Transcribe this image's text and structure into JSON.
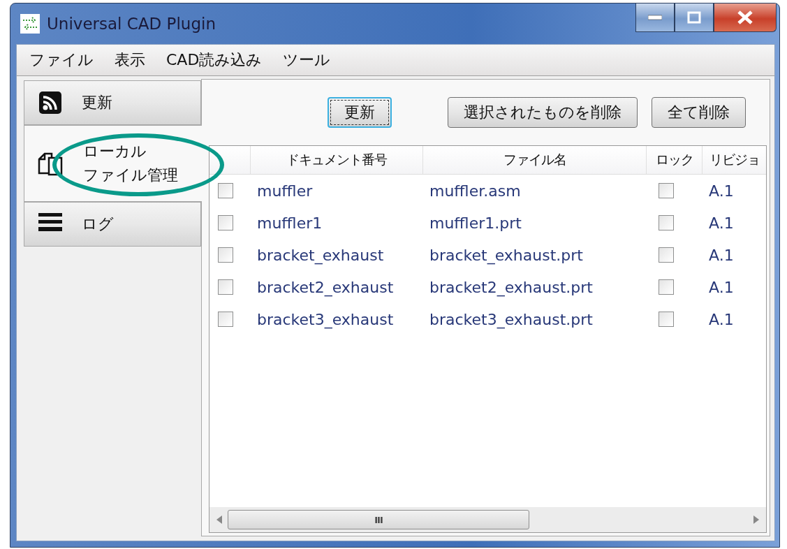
{
  "window": {
    "title": "Universal CAD Plugin"
  },
  "menu": [
    "ファイル",
    "表示",
    "CAD読み込み",
    "ツール"
  ],
  "sidebar": {
    "items": [
      {
        "lines": [
          "更新"
        ],
        "kind": "rss",
        "selected": false
      },
      {
        "lines": [
          "ローカル",
          "ファイル管理"
        ],
        "kind": "files",
        "selected": true
      },
      {
        "lines": [
          "ログ"
        ],
        "kind": "list",
        "selected": false
      }
    ]
  },
  "toolbar": {
    "buttons": [
      {
        "label": "更新",
        "focused": true
      },
      {
        "label": "選択されたものを削除",
        "focused": false
      },
      {
        "label": "全て削除",
        "focused": false
      }
    ]
  },
  "table": {
    "columns": [
      "ドキュメント番号",
      "ファイル名",
      "ロック",
      "リビジョ"
    ],
    "rows": [
      {
        "checked": false,
        "document": "muffler",
        "file": "muffler.asm",
        "locked": false,
        "revision": "A.1"
      },
      {
        "checked": false,
        "document": "muffler1",
        "file": "muffler1.prt",
        "locked": false,
        "revision": "A.1"
      },
      {
        "checked": false,
        "document": "bracket_exhaust",
        "file": "bracket_exhaust.prt",
        "locked": false,
        "revision": "A.1"
      },
      {
        "checked": false,
        "document": "bracket2_exhaust",
        "file": "bracket2_exhaust.prt",
        "locked": false,
        "revision": "A.1"
      },
      {
        "checked": false,
        "document": "bracket3_exhaust",
        "file": "bracket3_exhaust.prt",
        "locked": false,
        "revision": "A.1"
      }
    ]
  },
  "scrollbar_grip": "III"
}
